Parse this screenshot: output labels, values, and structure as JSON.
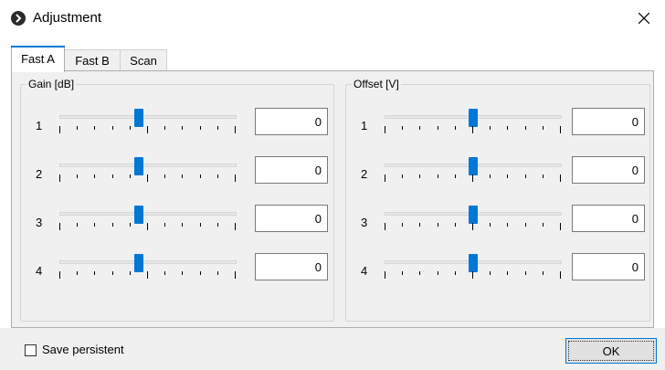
{
  "window": {
    "title": "Adjustment"
  },
  "tabs": [
    {
      "label": "Fast A",
      "active": true
    },
    {
      "label": "Fast B",
      "active": false
    },
    {
      "label": "Scan",
      "active": false
    }
  ],
  "groups": [
    {
      "legend": "Gain [dB]",
      "rows": [
        {
          "label": "1",
          "value": "0",
          "slider_level": 0.45
        },
        {
          "label": "2",
          "value": "0",
          "slider_level": 0.45
        },
        {
          "label": "3",
          "value": "0",
          "slider_level": 0.45
        },
        {
          "label": "4",
          "value": "0",
          "slider_level": 0.45
        }
      ]
    },
    {
      "legend": "Offset [V]",
      "rows": [
        {
          "label": "1",
          "value": "0",
          "slider_level": 0.5
        },
        {
          "label": "2",
          "value": "0",
          "slider_level": 0.5
        },
        {
          "label": "3",
          "value": "0",
          "slider_level": 0.5
        },
        {
          "label": "4",
          "value": "0",
          "slider_level": 0.5
        }
      ]
    }
  ],
  "footer": {
    "checkbox_label": "Save persistent",
    "checked": false,
    "ok_label": "OK"
  },
  "colors": {
    "accent": "#0078d7",
    "panel": "#f0f0f0"
  },
  "icons": {
    "app": "chevron-right-icon",
    "close": "close-icon"
  }
}
